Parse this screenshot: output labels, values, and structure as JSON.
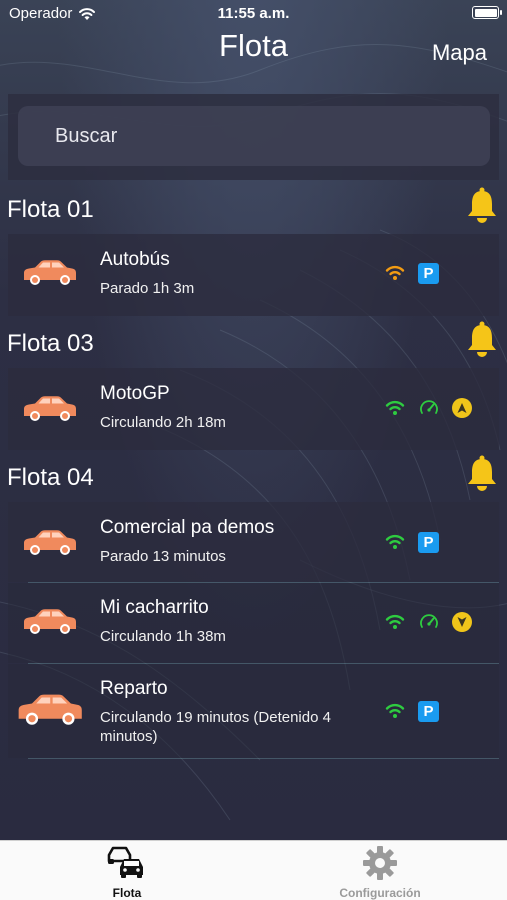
{
  "statusbar": {
    "carrier": "Operador",
    "time": "11:55 a.m."
  },
  "nav": {
    "title": "Flota",
    "map_button": "Mapa"
  },
  "search": {
    "placeholder": "Buscar"
  },
  "colors": {
    "wifi_green": "#2ecc40",
    "wifi_orange": "#f39c12",
    "parking_blue": "#1a9bf0",
    "bell_yellow": "#f5c518",
    "car": "#f08a5d"
  },
  "sections": [
    {
      "title": "Flota 01",
      "vehicles": [
        {
          "name": "Autobús",
          "status": "Parado 1h 3m",
          "icons": [
            "wifi-orange-icon",
            "parking-icon"
          ]
        }
      ]
    },
    {
      "title": "Flota 03",
      "vehicles": [
        {
          "name": "MotoGP",
          "status": "Circulando 2h 18m",
          "icons": [
            "wifi-green-icon",
            "speedometer-icon",
            "direction-north-icon"
          ]
        }
      ]
    },
    {
      "title": "Flota 04",
      "vehicles": [
        {
          "name": "Comercial pa demos",
          "status": "Parado 13 minutos",
          "icons": [
            "wifi-green-icon",
            "parking-icon"
          ]
        },
        {
          "name": "Mi cacharrito",
          "status": "Circulando 1h 38m",
          "icons": [
            "wifi-green-icon",
            "speedometer-icon",
            "direction-south-icon"
          ]
        },
        {
          "name": "Reparto",
          "status": "Circulando 19 minutos (Detenido 4 minutos)",
          "icons": [
            "wifi-green-icon",
            "parking-icon"
          ]
        }
      ]
    }
  ],
  "parking_letter": "P",
  "tabs": [
    {
      "label": "Flota",
      "active": true
    },
    {
      "label": "Configuración",
      "active": false
    }
  ]
}
